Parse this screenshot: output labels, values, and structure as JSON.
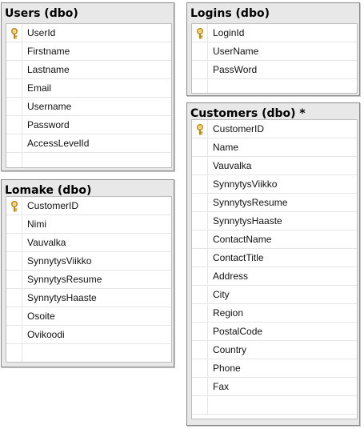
{
  "tables": [
    {
      "id": "users",
      "title": "Users (dbo)",
      "columns": [
        {
          "name": "UserId",
          "primary_key": true
        },
        {
          "name": "Firstname"
        },
        {
          "name": "Lastname"
        },
        {
          "name": "Email"
        },
        {
          "name": "Username"
        },
        {
          "name": "Password"
        },
        {
          "name": "AccessLevelId"
        }
      ]
    },
    {
      "id": "logins",
      "title": "Logins (dbo)",
      "columns": [
        {
          "name": "LoginId",
          "primary_key": true
        },
        {
          "name": "UserName"
        },
        {
          "name": "PassWord"
        }
      ]
    },
    {
      "id": "lomake",
      "title": "Lomake (dbo)",
      "columns": [
        {
          "name": "CustomerID",
          "primary_key": true
        },
        {
          "name": "Nimi"
        },
        {
          "name": "Vauvalka"
        },
        {
          "name": "SynnytysViikko"
        },
        {
          "name": "SynnytysResume"
        },
        {
          "name": "SynnytysHaaste"
        },
        {
          "name": "Osoite"
        },
        {
          "name": "Ovikoodi"
        }
      ]
    },
    {
      "id": "customers",
      "title": "Customers (dbo) *",
      "columns": [
        {
          "name": "CustomerID",
          "primary_key": true
        },
        {
          "name": "Name"
        },
        {
          "name": "Vauvalka"
        },
        {
          "name": "SynnytysViikko"
        },
        {
          "name": "SynnytysResume"
        },
        {
          "name": "SynnytysHaaste"
        },
        {
          "name": "ContactName"
        },
        {
          "name": "ContactTitle"
        },
        {
          "name": "Address"
        },
        {
          "name": "City"
        },
        {
          "name": "Region"
        },
        {
          "name": "PostalCode"
        },
        {
          "name": "Country"
        },
        {
          "name": "Phone"
        },
        {
          "name": "Fax"
        }
      ]
    }
  ],
  "icons": {
    "primary_key": "key-icon"
  },
  "colors": {
    "title_bar": "#e8e8e8",
    "border": "#8a8a8a",
    "key": "#d4a017"
  }
}
